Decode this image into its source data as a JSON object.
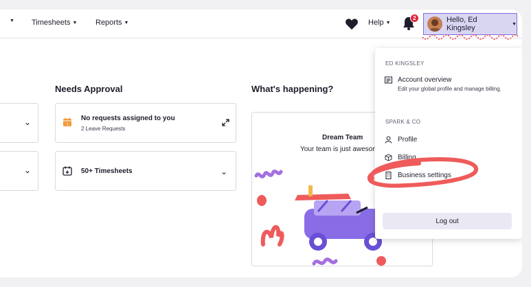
{
  "nav": {
    "timesheets": "Timesheets",
    "reports": "Reports",
    "help": "Help",
    "notification_count": "2",
    "greeting": "Hello, Ed Kingsley"
  },
  "main": {
    "needs_approval_title": "Needs Approval",
    "whats_happening_title": "What's happening?",
    "cards": [
      {
        "title": "No requests assigned to you",
        "subtitle": "2 Leave Requests",
        "icon": "calendar-icon"
      },
      {
        "title": "50+ Timesheets",
        "icon": "calendar-plus-icon"
      }
    ],
    "team_name": "Dream Team",
    "team_message": "Your team is just awesom"
  },
  "dropdown": {
    "user_header": "ED KINGSLEY",
    "account_overview": "Account overview",
    "account_desc": "Edit your global profile and manage billing.",
    "org_header": "SPARK & CO",
    "profile": "Profile",
    "billing": "Billing",
    "business_settings": "Business settings",
    "logout": "Log out"
  },
  "colors": {
    "accent": "#7c6ee0",
    "badge": "#e0253a",
    "annotation": "#ef5b5b",
    "calendar_orange": "#f39a3a"
  }
}
